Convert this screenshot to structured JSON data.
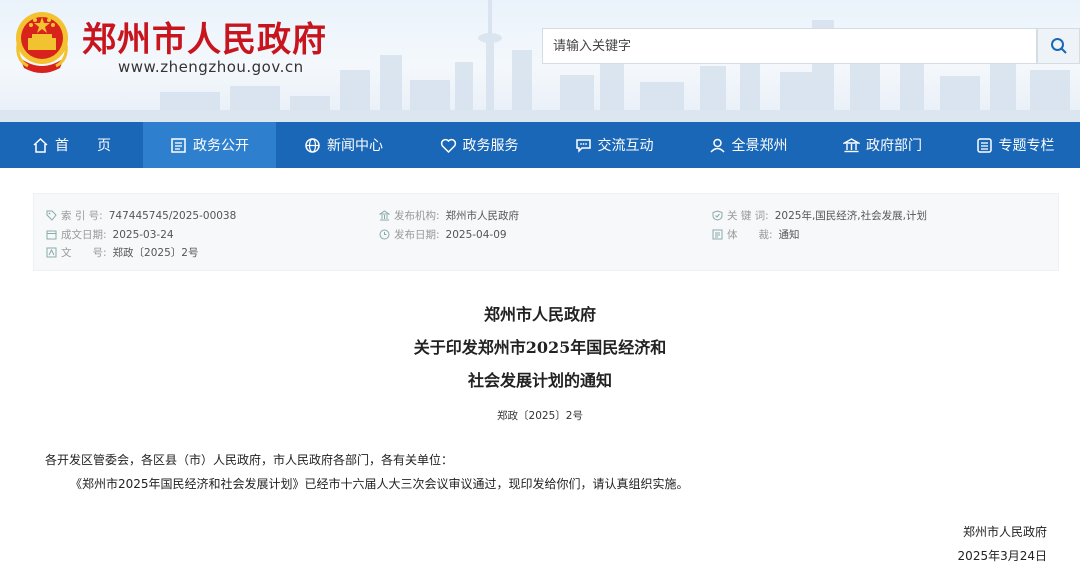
{
  "header": {
    "title": "郑州市人民政府",
    "url": "www.zhengzhou.gov.cn",
    "search_placeholder": "请输入关键字"
  },
  "nav": [
    {
      "label": "首　　页",
      "icon": "home-icon"
    },
    {
      "label": "政务公开",
      "icon": "document-icon",
      "active": true
    },
    {
      "label": "新闻中心",
      "icon": "globe-icon"
    },
    {
      "label": "政务服务",
      "icon": "heart-icon"
    },
    {
      "label": "交流互动",
      "icon": "chat-icon"
    },
    {
      "label": "全景郑州",
      "icon": "user-location-icon"
    },
    {
      "label": "政府部门",
      "icon": "building-icon"
    },
    {
      "label": "专题专栏",
      "icon": "list-icon"
    }
  ],
  "meta": {
    "index_label": "索 引 号:",
    "index_value": "747445745/2025-00038",
    "date_created_label": "成文日期:",
    "date_created_value": "2025-03-24",
    "doc_no_label": "文　　号:",
    "doc_no_value": "郑政〔2025〕2号",
    "publisher_label": "发布机构:",
    "publisher_value": "郑州市人民政府",
    "publish_date_label": "发布日期:",
    "publish_date_value": "2025-04-09",
    "keywords_label": "关 键 词:",
    "keywords_value": "2025年,国民经济,社会发展,计划",
    "genre_label": "体　　裁:",
    "genre_value": "通知"
  },
  "document": {
    "title_line1": "郑州市人民政府",
    "title_line2": "关于印发郑州市2025年国民经济和",
    "title_line3": "社会发展计划的通知",
    "doc_number": "郑政〔2025〕2号",
    "salutation": "各开发区管委会，各区县（市）人民政府，市人民政府各部门，各有关单位：",
    "body": "《郑州市2025年国民经济和社会发展计划》已经市十六届人大三次会议审议通过，现印发给你们，请认真组织实施。",
    "signature": "郑州市人民政府",
    "date": "2025年3月24日"
  },
  "colors": {
    "title_red": "#c8151d",
    "nav_blue": "#1a67b7",
    "nav_active": "#2f7fcf"
  }
}
